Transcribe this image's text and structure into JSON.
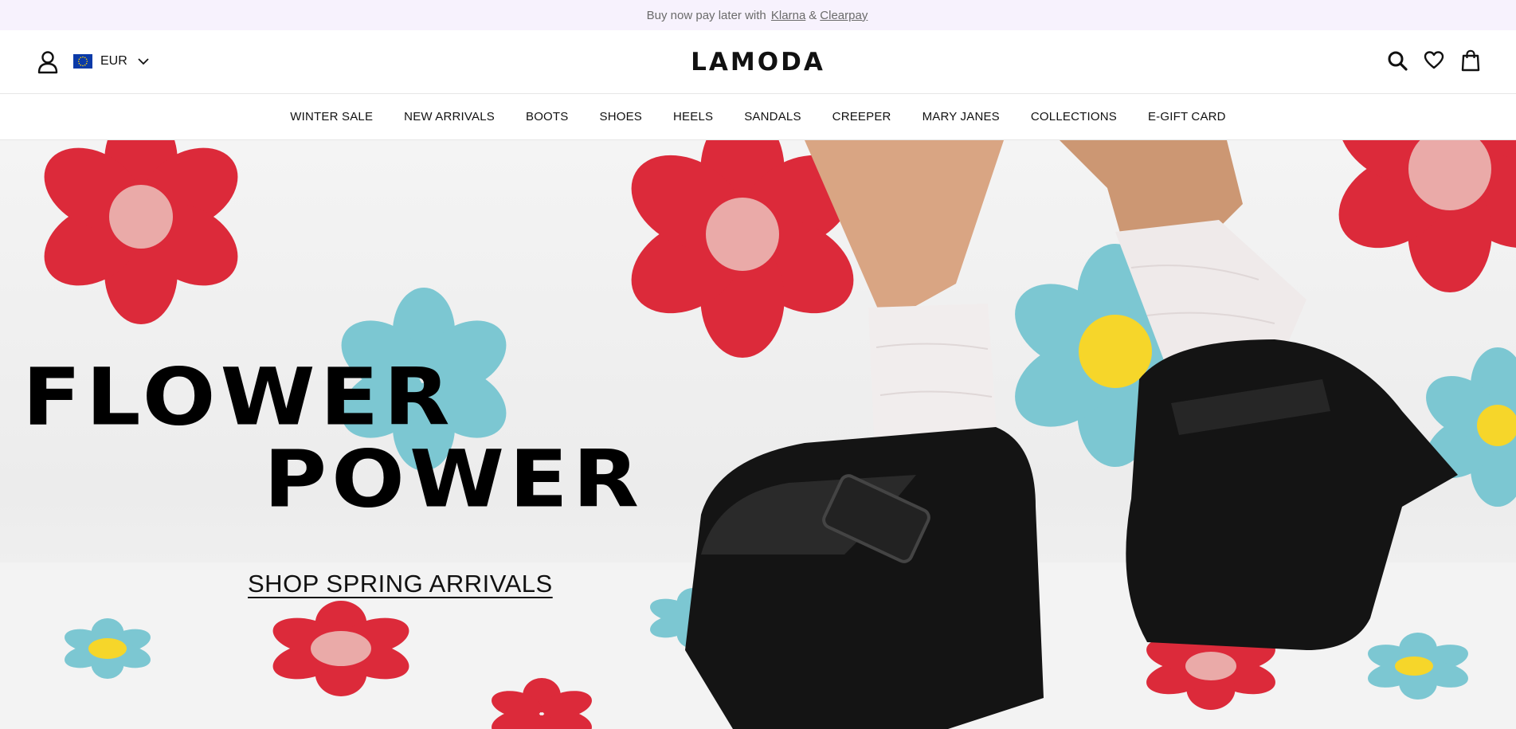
{
  "promo_bar": {
    "prefix": "Buy now pay later with",
    "link_klarna": "Klarna",
    "separator": "&",
    "link_clearpay": "Clearpay"
  },
  "header": {
    "currency": "EUR",
    "logo": "LAMODA",
    "icons": [
      "account-icon",
      "eu-flag-icon",
      "chevron-down-icon",
      "search-icon",
      "heart-icon",
      "bag-icon"
    ]
  },
  "nav": {
    "items": [
      "WINTER SALE",
      "NEW ARRIVALS",
      "BOOTS",
      "SHOES",
      "HEELS",
      "SANDALS",
      "CREEPER",
      "MARY JANES",
      "COLLECTIONS",
      "E-GIFT CARD"
    ]
  },
  "hero": {
    "headline_line1": "FLOWER",
    "headline_line2": "POWER",
    "cta": "SHOP SPRING ARRIVALS"
  },
  "colors": {
    "promo_bg": "#f7f2fd",
    "flower_red": "#dc2a3a",
    "flower_pink_center": "#eaaaa8",
    "flower_teal": "#7cc7d2",
    "flower_yellow": "#f6d62a",
    "shoe_black": "#141414"
  }
}
